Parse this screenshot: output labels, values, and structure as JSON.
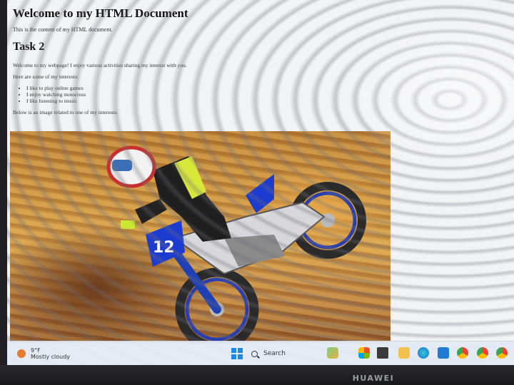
{
  "page": {
    "heading": "Welcome to my HTML Document",
    "intro": "This is the content of my HTML document.",
    "task_heading": "Task 2",
    "welcome": "Welcome to my webpage! I enjoy various activities sharing my interest with you.",
    "interests_intro": "Here are some of my interests:",
    "interests": [
      "I like to play online games",
      "I enjoy watching motocross",
      "I like listening to music"
    ],
    "image_intro": "Below is an image related to one of my interests:"
  },
  "taskbar": {
    "weather_temp": "9°F",
    "weather_desc": "Mostly cloudy",
    "search_label": "Search"
  },
  "device": {
    "brand": "HUAWEI"
  }
}
